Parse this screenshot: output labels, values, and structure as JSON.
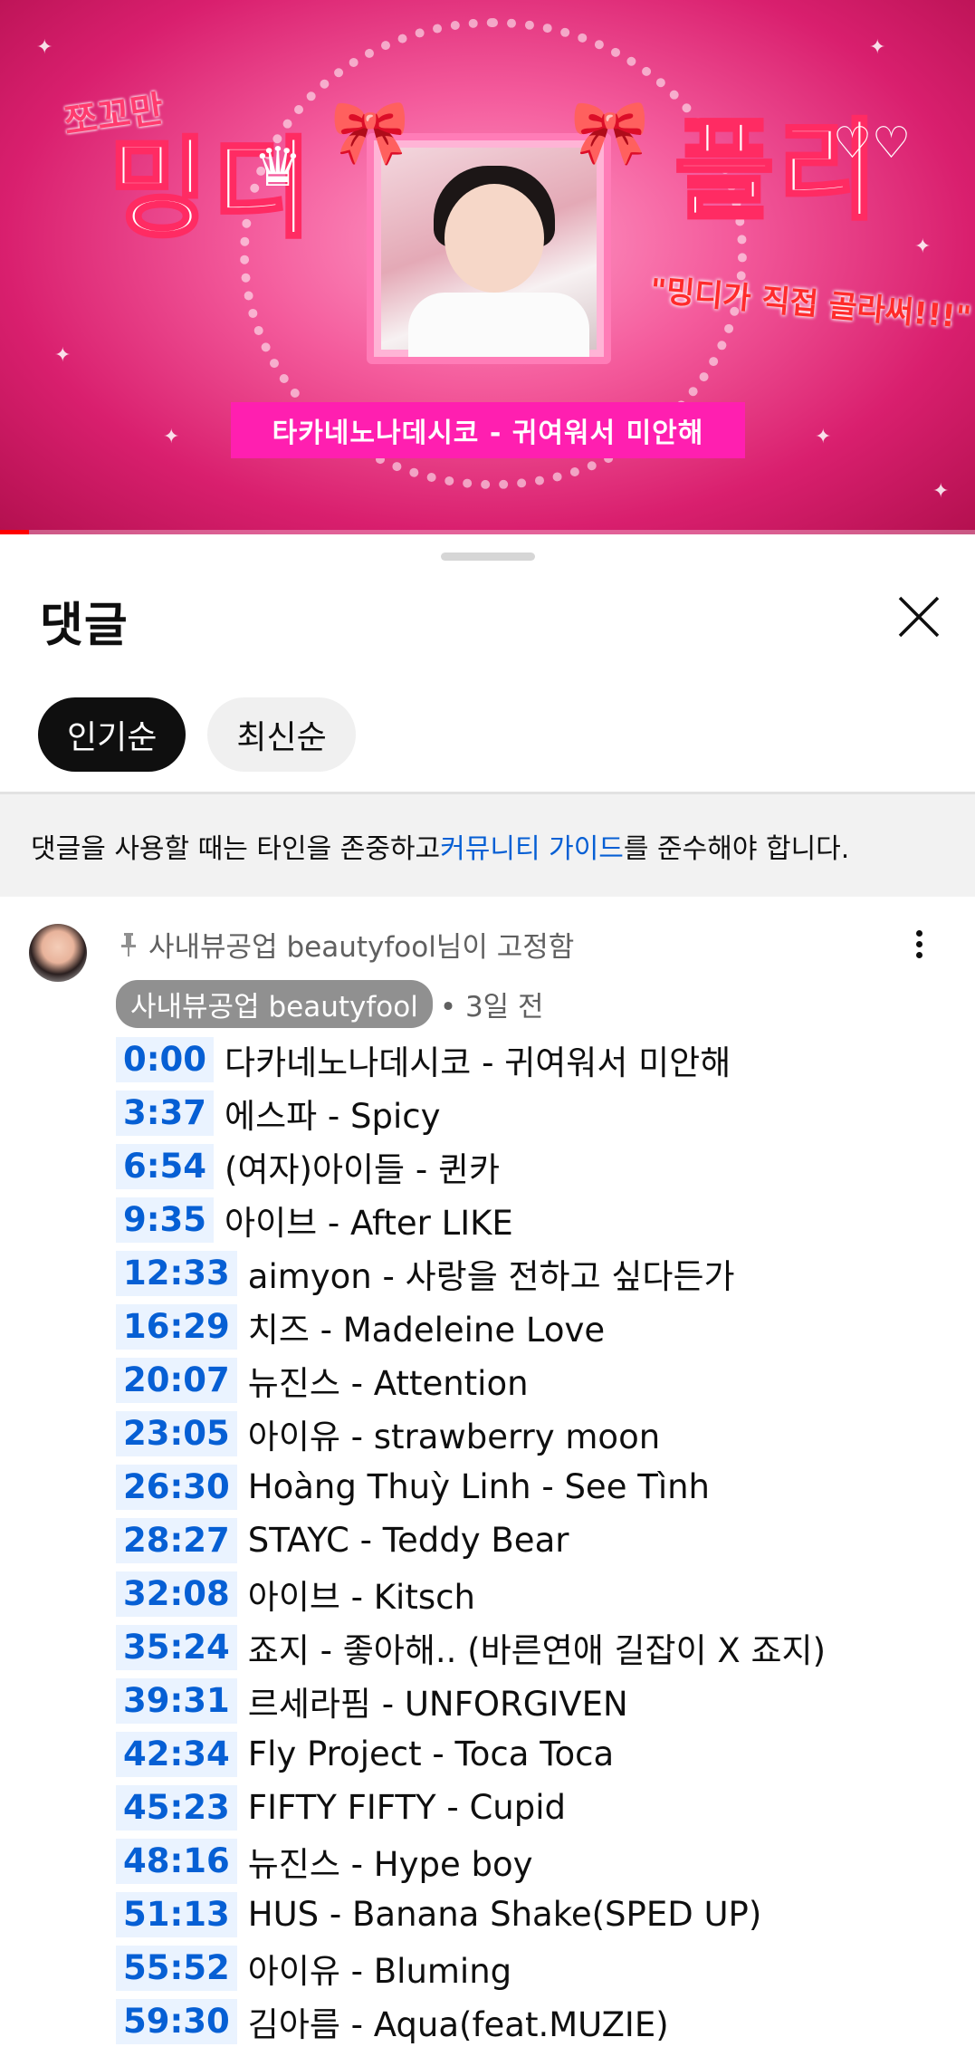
{
  "video": {
    "small_title": "쪼꼬만",
    "big_title_left": "밍디",
    "big_title_right": "플리",
    "subtitle": "\"밍디가 직접 골라써!!!\"",
    "caption": "타카네노나데시코 - 귀여워서 미안해",
    "progress_fraction": 0.03
  },
  "sheet": {
    "title": "댓글",
    "sort_chips": [
      {
        "label": "인기순",
        "active": true
      },
      {
        "label": "최신순",
        "active": false
      }
    ],
    "notice": {
      "before": "댓글을 사용할 때는 타인을 존중하고 ",
      "link": "커뮤니티 가이드",
      "after": "를 준수해야 합니다."
    }
  },
  "comment": {
    "pinned_text": "사내뷰공업 beautyfool님이 고정함",
    "author": "사내뷰공업 beautyfool",
    "time_ago": "• 3일 전",
    "tracks": [
      {
        "time": "0:00",
        "title": "다카네노나데시코 - 귀여워서 미안해"
      },
      {
        "time": "3:37",
        "title": "에스파 - Spicy"
      },
      {
        "time": "6:54",
        "title": "(여자)아이들 - 퀸카"
      },
      {
        "time": "9:35",
        "title": "아이브 - After LIKE"
      },
      {
        "time": "12:33",
        "title": "aimyon - 사랑을 전하고 싶다든가"
      },
      {
        "time": "16:29",
        "title": "치즈 - Madeleine Love"
      },
      {
        "time": "20:07",
        "title": "뉴진스 - Attention"
      },
      {
        "time": "23:05",
        "title": "아이유 - strawberry moon"
      },
      {
        "time": "26:30",
        "title": "Hoàng Thuỳ Linh - See Tình"
      },
      {
        "time": "28:27",
        "title": "STAYC - Teddy Bear"
      },
      {
        "time": "32:08",
        "title": "아이브 - Kitsch"
      },
      {
        "time": "35:24",
        "title": "죠지 - 좋아해.. (바른연애 길잡이 X 죠지)"
      },
      {
        "time": "39:31",
        "title": "르세라핌 - UNFORGIVEN"
      },
      {
        "time": "42:34",
        "title": "Fly Project - Toca Toca"
      },
      {
        "time": "45:23",
        "title": "FIFTY FIFTY - Cupid"
      },
      {
        "time": "48:16",
        "title": "뉴진스 - Hype boy"
      },
      {
        "time": "51:13",
        "title": "HUS - Banana Shake(SPED UP)"
      },
      {
        "time": "55:52",
        "title": "아이유 - Bluming"
      },
      {
        "time": "59:30",
        "title": "김아름 - Aqua(feat.MUZIE)"
      }
    ]
  },
  "icons": {
    "close": "close-icon",
    "pin": "pin-icon",
    "more": "more-vert-icon"
  },
  "colors": {
    "link_blue": "#065fd4",
    "chip_active": "#0f0f0f",
    "caption_bar": "#ff1fb0"
  }
}
